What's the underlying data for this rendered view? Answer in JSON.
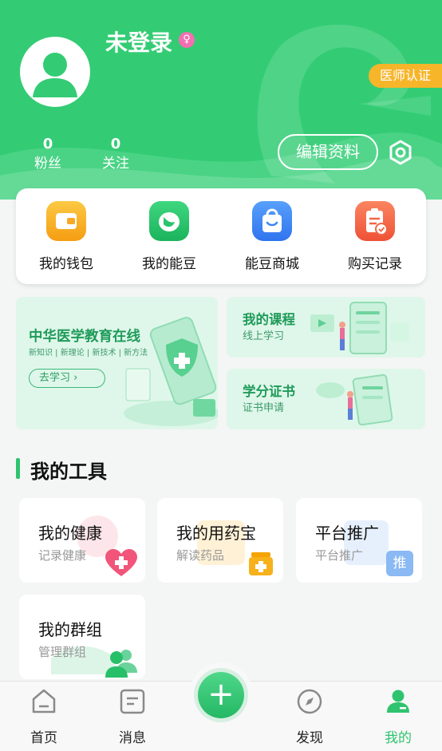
{
  "profile": {
    "username": "未登录",
    "gender_symbol": "♀",
    "doctor_badge": "医师认证",
    "stats": [
      {
        "value": "0",
        "label": "粉丝"
      },
      {
        "value": "0",
        "label": "关注"
      }
    ],
    "edit_button": "编辑资料"
  },
  "quick_menu": [
    {
      "label": "我的钱包",
      "icon": "wallet-icon",
      "color": "#f7a825"
    },
    {
      "label": "我的能豆",
      "icon": "bean-icon",
      "color": "#29c46c"
    },
    {
      "label": "能豆商城",
      "icon": "shopping-bag-icon",
      "color": "#3b86f4"
    },
    {
      "label": "购买记录",
      "icon": "clipboard-check-icon",
      "color": "#f26646"
    }
  ],
  "banners": {
    "main": {
      "title": "中华医学教育在线",
      "subtitle": "新知识 | 新理论 | 新技术 | 新方法",
      "button": "去学习 ›"
    },
    "courses": {
      "title": "我的课程",
      "subtitle": "线上学习"
    },
    "certificate": {
      "title": "学分证书",
      "subtitle": "证书申请"
    }
  },
  "tools": {
    "title": "我的工具",
    "items": [
      {
        "title": "我的健康",
        "subtitle": "记录健康",
        "icon": "heart-plus-icon"
      },
      {
        "title": "我的用药宝",
        "subtitle": "解读药品",
        "icon": "medicine-box-icon"
      },
      {
        "title": "平台推广",
        "subtitle": "平台推广",
        "icon": "promote-icon",
        "badge": "推"
      },
      {
        "title": "我的群组",
        "subtitle": "管理群组",
        "icon": "group-icon"
      }
    ]
  },
  "tabbar": {
    "tabs": [
      {
        "label": "首页",
        "icon": "home-icon"
      },
      {
        "label": "消息",
        "icon": "message-icon"
      },
      {
        "label": "发现",
        "icon": "compass-icon"
      },
      {
        "label": "我的",
        "icon": "user-icon",
        "active": true
      }
    ],
    "center_button_symbol": "+"
  },
  "colors": {
    "brand_green": "#33cc74",
    "badge_orange": "#f7b52a",
    "banner_bg": "#dff7ea"
  }
}
